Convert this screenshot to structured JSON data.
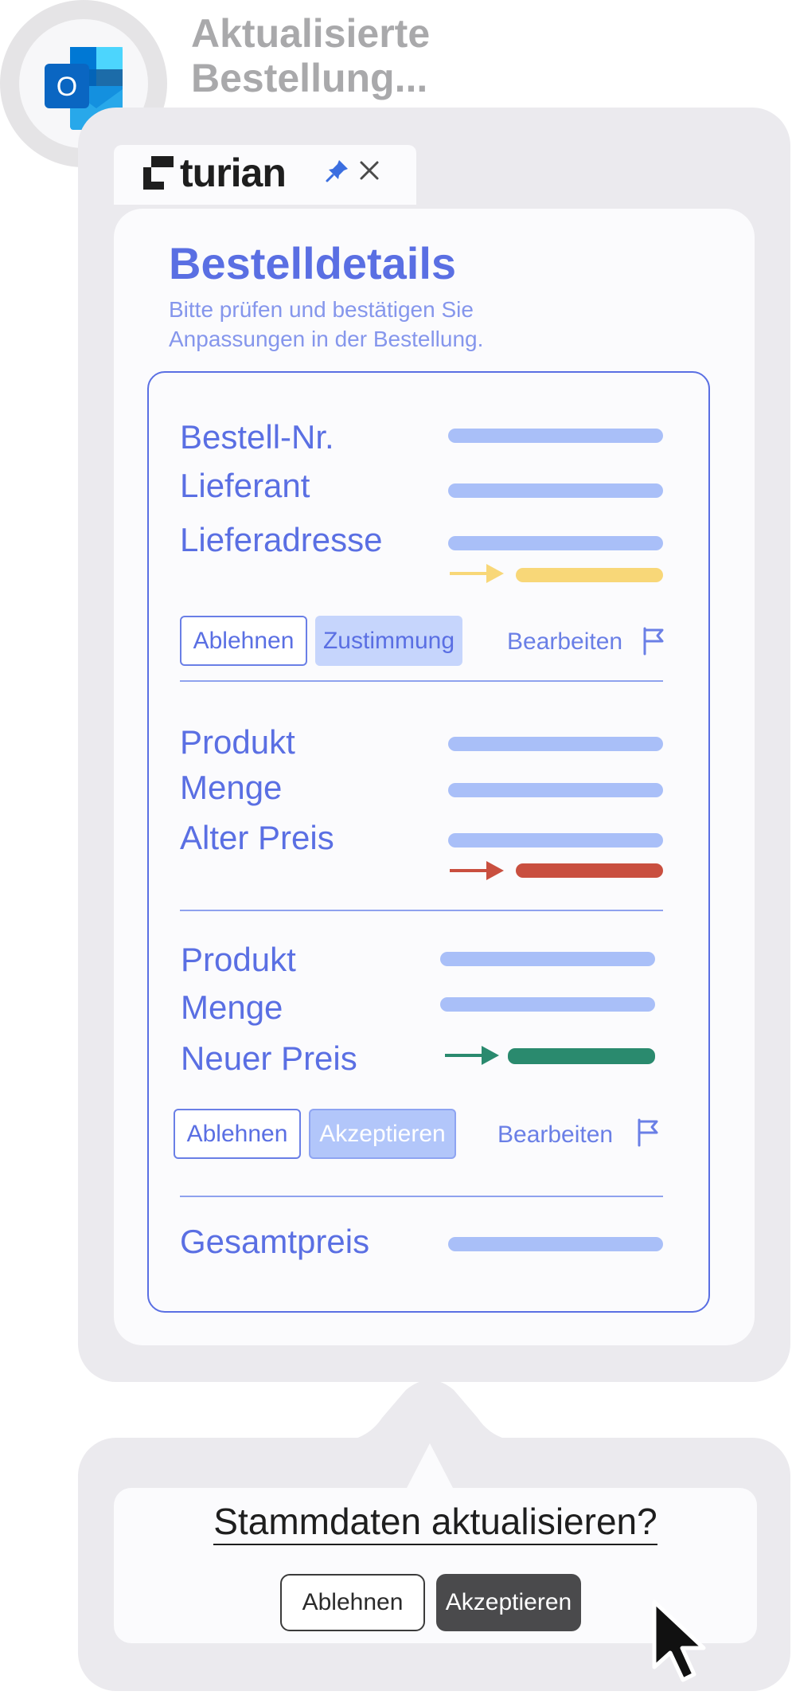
{
  "header": {
    "title": "Aktualisierte Bestellung..."
  },
  "addin": {
    "brand": "turian",
    "icons": [
      "pin-icon",
      "close-icon"
    ]
  },
  "details": {
    "title": "Bestelldetails",
    "subtitle": "Bitte prüfen und bestätigen Sie Anpassungen in der Bestellung."
  },
  "section1": {
    "labels": [
      "Bestell-Nr.",
      "Lieferant",
      "Lieferadresse"
    ],
    "reject": "Ablehnen",
    "approve": "Zustimmung",
    "edit": "Bearbeiten"
  },
  "section2": {
    "labels": [
      "Produkt",
      "Menge",
      "Alter Preis"
    ]
  },
  "section3": {
    "labels": [
      "Produkt",
      "Menge",
      "Neuer Preis"
    ],
    "reject": "Ablehnen",
    "accept": "Akzeptieren",
    "edit": "Bearbeiten"
  },
  "total": {
    "label": "Gesamtpreis"
  },
  "dialog": {
    "question": "Stammdaten aktualisieren?",
    "reject": "Ablehnen",
    "accept": "Akzeptieren"
  },
  "colors": {
    "accent": "#5a6fe3",
    "placeholder_bar": "#a9bff8",
    "change_yellow": "#f8d778",
    "change_red": "#c94f3f",
    "change_green": "#2a8a6e"
  }
}
